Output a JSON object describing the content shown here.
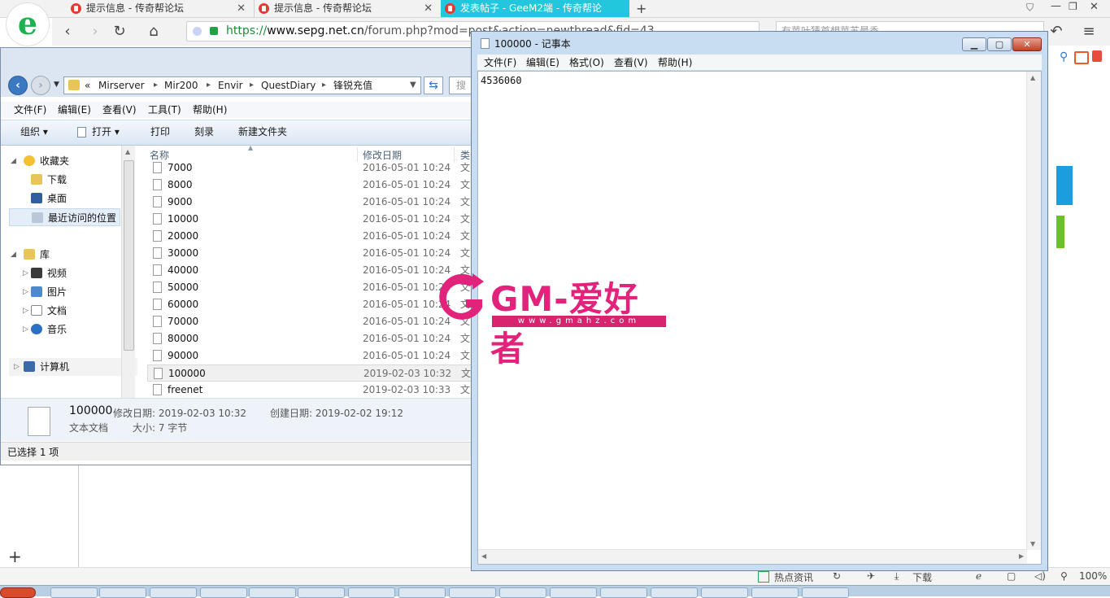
{
  "browser": {
    "tabs": [
      {
        "label": "提示信息 - 传奇帮论坛",
        "close": "✕"
      },
      {
        "label": "提示信息 - 传奇帮论坛",
        "close": "✕"
      },
      {
        "label": "发表帖子 - GeeM2端 - 传奇帮论",
        "close": "✕"
      }
    ],
    "new_tab": "+",
    "address": {
      "scheme": "https://",
      "host": "www.sepg.net.cn",
      "path": "/forum.php?mod=post&action=newthread&fid=43"
    },
    "search_text": "有苹叶猜首想苹苏最香",
    "logo_letter": "e",
    "status": {
      "hot_news": "热点资讯",
      "download": "下载",
      "zoom": "100%"
    }
  },
  "explorer": {
    "breadcrumb": [
      "«",
      "Mirserver",
      "Mir200",
      "Envir",
      "QuestDiary",
      "锋锐充值"
    ],
    "search_placeholder": "搜索",
    "menu": [
      "文件(F)",
      "编辑(E)",
      "查看(V)",
      "工具(T)",
      "帮助(H)"
    ],
    "toolbar": [
      "组织 ▾",
      "打开 ▾",
      "打印",
      "刻录",
      "新建文件夹"
    ],
    "nav": [
      {
        "label": "收藏夹"
      },
      {
        "label": "下载"
      },
      {
        "label": "桌面"
      },
      {
        "label": "最近访问的位置"
      },
      {
        "label": "库"
      },
      {
        "label": "视频"
      },
      {
        "label": "图片"
      },
      {
        "label": "文档"
      },
      {
        "label": "音乐"
      },
      {
        "label": "计算机"
      }
    ],
    "columns": [
      "名称",
      "修改日期",
      "类"
    ],
    "files": [
      {
        "name": "7000",
        "date": "2016-05-01 10:24",
        "type": "文"
      },
      {
        "name": "8000",
        "date": "2016-05-01 10:24",
        "type": "文"
      },
      {
        "name": "9000",
        "date": "2016-05-01 10:24",
        "type": "文"
      },
      {
        "name": "10000",
        "date": "2016-05-01 10:24",
        "type": "文"
      },
      {
        "name": "20000",
        "date": "2016-05-01 10:24",
        "type": "文"
      },
      {
        "name": "30000",
        "date": "2016-05-01 10:24",
        "type": "文"
      },
      {
        "name": "40000",
        "date": "2016-05-01 10:24",
        "type": "文"
      },
      {
        "name": "50000",
        "date": "2016-05-01 10:24",
        "type": "文"
      },
      {
        "name": "60000",
        "date": "2016-05-01 10:24",
        "type": "文"
      },
      {
        "name": "70000",
        "date": "2016-05-01 10:24",
        "type": "文"
      },
      {
        "name": "80000",
        "date": "2016-05-01 10:24",
        "type": "文"
      },
      {
        "name": "90000",
        "date": "2016-05-01 10:24",
        "type": "文"
      },
      {
        "name": "100000",
        "date": "2019-02-03 10:32",
        "type": "文"
      },
      {
        "name": "freenet",
        "date": "2019-02-03 10:33",
        "type": "文"
      }
    ],
    "details": {
      "name": "100000",
      "modified": "修改日期: 2019-02-03 10:32",
      "created": "创建日期: 2019-02-02 19:12",
      "kind": "文本文档",
      "size": "大小: 7 字节"
    },
    "status": "已选择 1 项"
  },
  "notepad": {
    "title": "100000 - 记事本",
    "menu": [
      "文件(F)",
      "编辑(E)",
      "格式(O)",
      "查看(V)",
      "帮助(H)"
    ],
    "content": "4536060"
  },
  "watermark": {
    "title": "GM-爱好者",
    "url": "www.gmahz.com"
  },
  "colors": {
    "accent_tab": "#22c7dd",
    "watermark": "#e3227c",
    "selection": "#e4eef9"
  }
}
